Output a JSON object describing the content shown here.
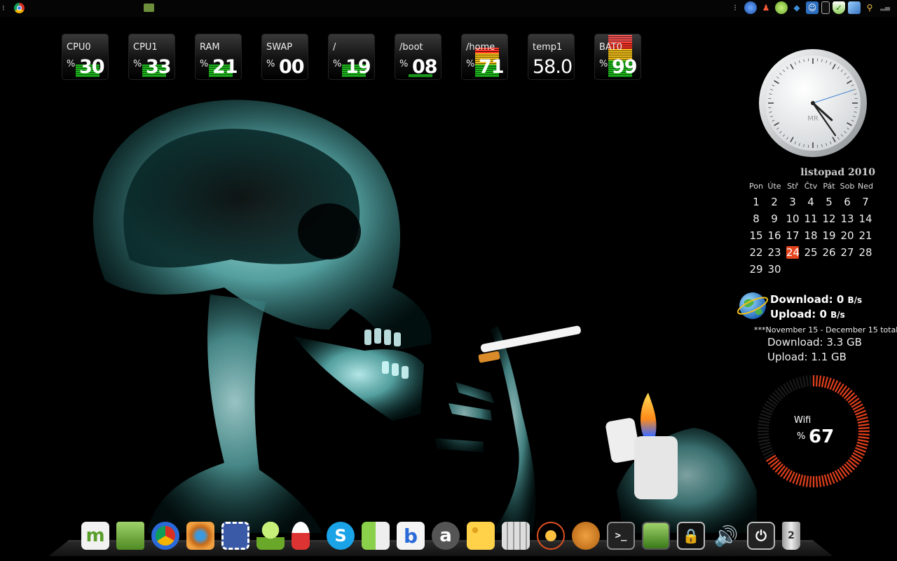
{
  "top_panel": {
    "tray_icons": [
      "menu-icon",
      "thunderbird-icon",
      "user-icon",
      "pidgin-icon",
      "dropbox-icon",
      "accessibility-icon",
      "battery-icon",
      "shield-icon",
      "network-icon",
      "search-icon",
      "signal-icon"
    ]
  },
  "meters": [
    {
      "label": "CPU0",
      "value": "30",
      "unit": "%",
      "level": 0.3
    },
    {
      "label": "CPU1",
      "value": "33",
      "unit": "%",
      "level": 0.33
    },
    {
      "label": "RAM",
      "value": "21",
      "unit": "%",
      "level": 0.21
    },
    {
      "label": "SWAP",
      "value": "00",
      "unit": "%",
      "level": 0.0
    },
    {
      "label": "/",
      "value": "19",
      "unit": "%",
      "level": 0.19
    },
    {
      "label": "/boot",
      "value": "08",
      "unit": "%",
      "level": 0.08
    },
    {
      "label": "/home",
      "value": "71",
      "unit": "%",
      "level": 0.71
    },
    {
      "label": "temp1",
      "value": "58.0",
      "unit": ""
    },
    {
      "label": "BAT0",
      "value": "99",
      "unit": "%",
      "level": 0.99
    }
  ],
  "clock": {
    "brand": "MR",
    "hour": 4,
    "minute": 24,
    "second": 12
  },
  "calendar": {
    "title": "listopad 2010",
    "weekdays": [
      "Pon",
      "Úte",
      "Stř",
      "Čtv",
      "Pát",
      "Sob",
      "Ned"
    ],
    "days": [
      "1",
      "2",
      "3",
      "4",
      "5",
      "6",
      "7",
      "8",
      "9",
      "10",
      "11",
      "12",
      "13",
      "14",
      "15",
      "16",
      "17",
      "18",
      "19",
      "20",
      "21",
      "22",
      "23",
      "24",
      "25",
      "26",
      "27",
      "28",
      "29",
      "30"
    ],
    "today": "24"
  },
  "network": {
    "download_label": "Download:",
    "download_value": "0",
    "download_unit": "B/s",
    "upload_label": "Upload:",
    "upload_value": "0",
    "upload_unit": "B/s",
    "period": "***November 15 - December 15 total:",
    "total_download": "Download: 3.3 GB",
    "total_upload": "Upload: 1.1 GB"
  },
  "wifi": {
    "label": "Wifi",
    "unit": "%",
    "value": "67",
    "level": 0.67
  },
  "dock": {
    "items": [
      {
        "name": "mint-menu-icon",
        "glyph": "m"
      },
      {
        "name": "folder-icon",
        "glyph": ""
      },
      {
        "name": "chrome-icon",
        "glyph": ""
      },
      {
        "name": "eye-of-gnome-icon",
        "glyph": ""
      },
      {
        "name": "mail-stamp-icon",
        "glyph": ""
      },
      {
        "name": "pidgin-icon",
        "glyph": ""
      },
      {
        "name": "rocket-icon",
        "glyph": ""
      },
      {
        "name": "skype-icon",
        "glyph": "S"
      },
      {
        "name": "phone-sms-icon",
        "glyph": ""
      },
      {
        "name": "blogger-icon",
        "glyph": "b"
      },
      {
        "name": "amarok-icon",
        "glyph": "a"
      },
      {
        "name": "cheese-icon",
        "glyph": ""
      },
      {
        "name": "calculator-icon",
        "glyph": ""
      },
      {
        "name": "stellarium-icon",
        "glyph": ""
      },
      {
        "name": "cat-icon",
        "glyph": ""
      },
      {
        "name": "terminal-icon",
        "glyph": ">_"
      },
      {
        "name": "desktop-icon",
        "glyph": ""
      },
      {
        "name": "lock-icon",
        "glyph": ""
      },
      {
        "name": "volume-icon",
        "glyph": ""
      },
      {
        "name": "power-icon",
        "glyph": ""
      },
      {
        "name": "trash-icon",
        "glyph": "2"
      }
    ]
  }
}
